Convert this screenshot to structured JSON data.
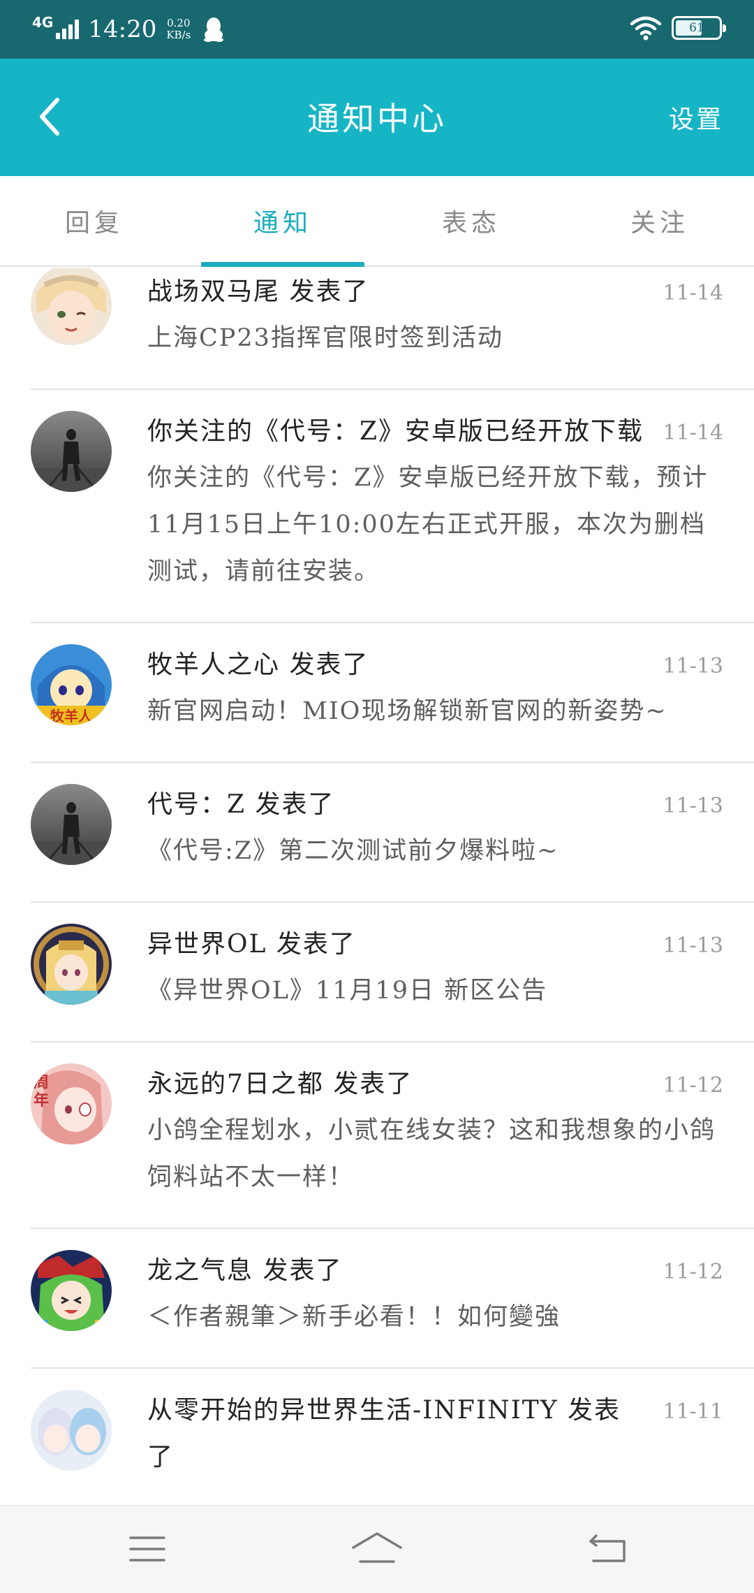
{
  "status_bar": {
    "network": "4G",
    "time": "14:20",
    "speed_value": "0.20",
    "speed_unit": "KB/s",
    "battery": "61",
    "battery_level": 0.61
  },
  "header": {
    "title": "通知中心",
    "settings_label": "设置"
  },
  "tabs": [
    {
      "label": "回复",
      "active": false
    },
    {
      "label": "通知",
      "active": true
    },
    {
      "label": "表态",
      "active": false
    },
    {
      "label": "关注",
      "active": false
    }
  ],
  "notifications": [
    {
      "title": "战场双马尾 发表了",
      "date": "11-14",
      "body": "上海CP23指挥官限时签到活动",
      "avatar": "anime-girl-cream-avatar"
    },
    {
      "title": "你关注的《代号：Z》安卓版已经开放下载",
      "date": "11-14",
      "body": "你关注的《代号：Z》安卓版已经开放下载，预计11月15日上午10:00左右正式开服，本次为删档测试，请前往安装。",
      "avatar": "gray-walking-figure-avatar"
    },
    {
      "title": "牧羊人之心 发表了",
      "date": "11-13",
      "body": "新官网启动！MIO现场解锁新官网的新姿势~",
      "avatar": "blue-hair-girl-avatar"
    },
    {
      "title": "代号：Z 发表了",
      "date": "11-13",
      "body": "《代号:Z》第二次测试前夕爆料啦~",
      "avatar": "gray-walking-figure-avatar"
    },
    {
      "title": "异世界OL 发表了",
      "date": "11-13",
      "body": "《异世界OL》11月19日 新区公告",
      "avatar": "ornate-blonde-girl-avatar"
    },
    {
      "title": "永远的7日之都 发表了",
      "date": "11-12",
      "body": "小鸽全程划水，小贰在线女装？这和我想象的小鸽饲料站不太一样！",
      "avatar": "pink-anniversary-girl-avatar"
    },
    {
      "title": "龙之气息 发表了",
      "date": "11-12",
      "body": "＜作者親筆＞新手必看！！如何變強",
      "avatar": "green-hair-chibi-avatar"
    },
    {
      "title": "从零开始的异世界生活-INFINITY 发表了",
      "date": "11-11",
      "body": "",
      "avatar": "rezero-twins-avatar"
    }
  ],
  "colors": {
    "status_bar": "#17686f",
    "header": "#16b5c6",
    "accent": "#19adbd"
  },
  "bottom_nav": {
    "icons": [
      "menu-icon",
      "home-icon",
      "back-icon"
    ]
  }
}
